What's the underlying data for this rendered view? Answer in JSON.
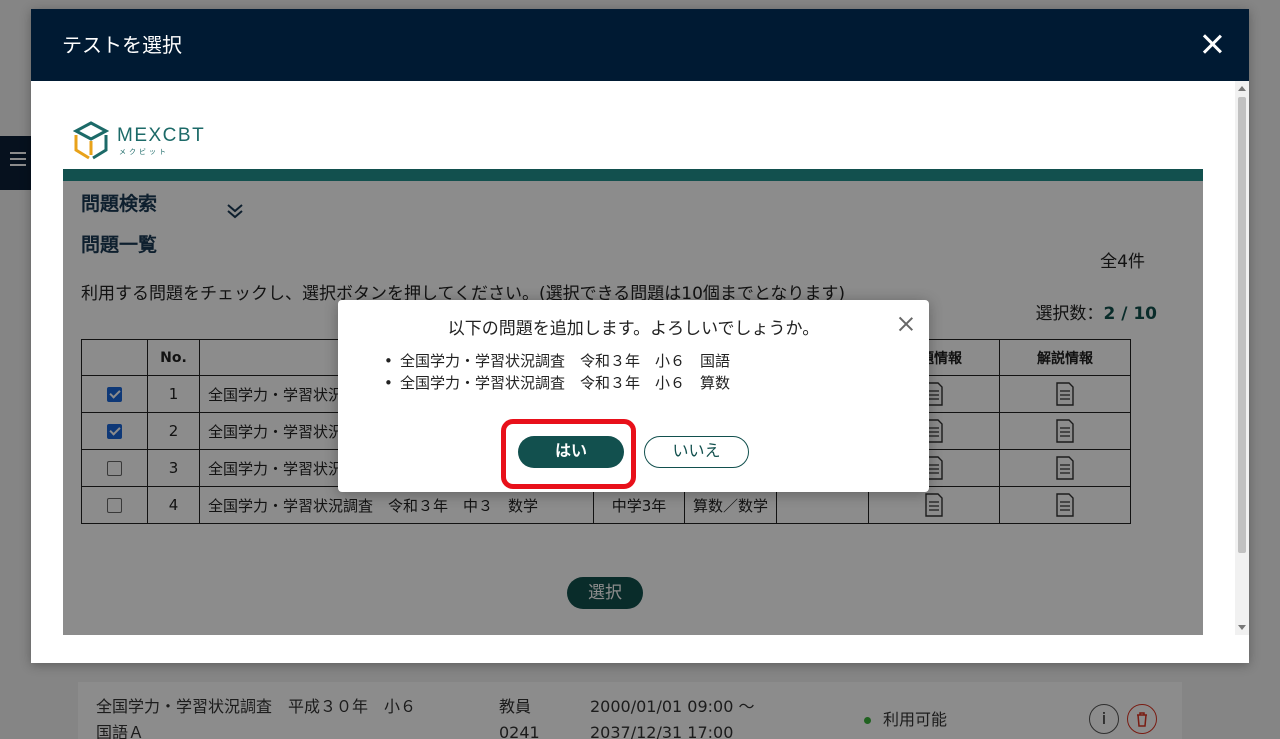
{
  "background": {
    "row": {
      "title_line1": "全国学力・学習状況調査　平成３０年　小６",
      "title_line2": "国語Ａ",
      "role_line1": "教員",
      "role_line2": "0241",
      "period_line1": "2000/01/01 09:00 ～",
      "period_line2": "2037/12/31 17:00",
      "status": "利用可能",
      "info_button": "i"
    }
  },
  "modal": {
    "title": "テストを選択",
    "logo_text": "MEXCBT",
    "logo_sub": "メクビット",
    "search_title": "問題検索",
    "list_title": "問題一覧",
    "total": "全4件",
    "instructions": "利用する問題をチェックし、選択ボタンを押してください。(選択できる問題は10個までとなります)",
    "selection_label": "選択数：",
    "selection_count": "2",
    "selection_sep": " / ",
    "selection_max": "10",
    "table": {
      "headers": {
        "no": "No.",
        "problem_info": "問題情報",
        "explanation_info": "解説情報"
      },
      "rows": [
        {
          "no": "1",
          "title": "全国学力・学習状況調査　令和３年　小６　国語",
          "grade": "",
          "subject": "",
          "checked": true
        },
        {
          "no": "2",
          "title": "全国学力・学習状況調査　令和３年　小６　算数",
          "grade": "",
          "subject": "",
          "checked": true
        },
        {
          "no": "3",
          "title": "全国学力・学習状況調査　令和３年　中３　国語",
          "grade": "",
          "subject": "",
          "checked": false
        },
        {
          "no": "4",
          "title": "全国学力・学習状況調査　令和３年　中３　数学",
          "grade": "中学3年",
          "subject": "算数／数学",
          "checked": false
        }
      ]
    },
    "select_button": "選択"
  },
  "dialog": {
    "title": "以下の問題を追加します。よろしいでしょうか。",
    "items": [
      "全国学力・学習状況調査　令和３年　小６　国語",
      "全国学力・学習状況調査　令和３年　小６　算数"
    ],
    "yes": "はい",
    "no": "いいえ"
  },
  "colors": {
    "header_bg": "#001a33",
    "accent": "#12504e",
    "highlight": "#e8101a"
  }
}
